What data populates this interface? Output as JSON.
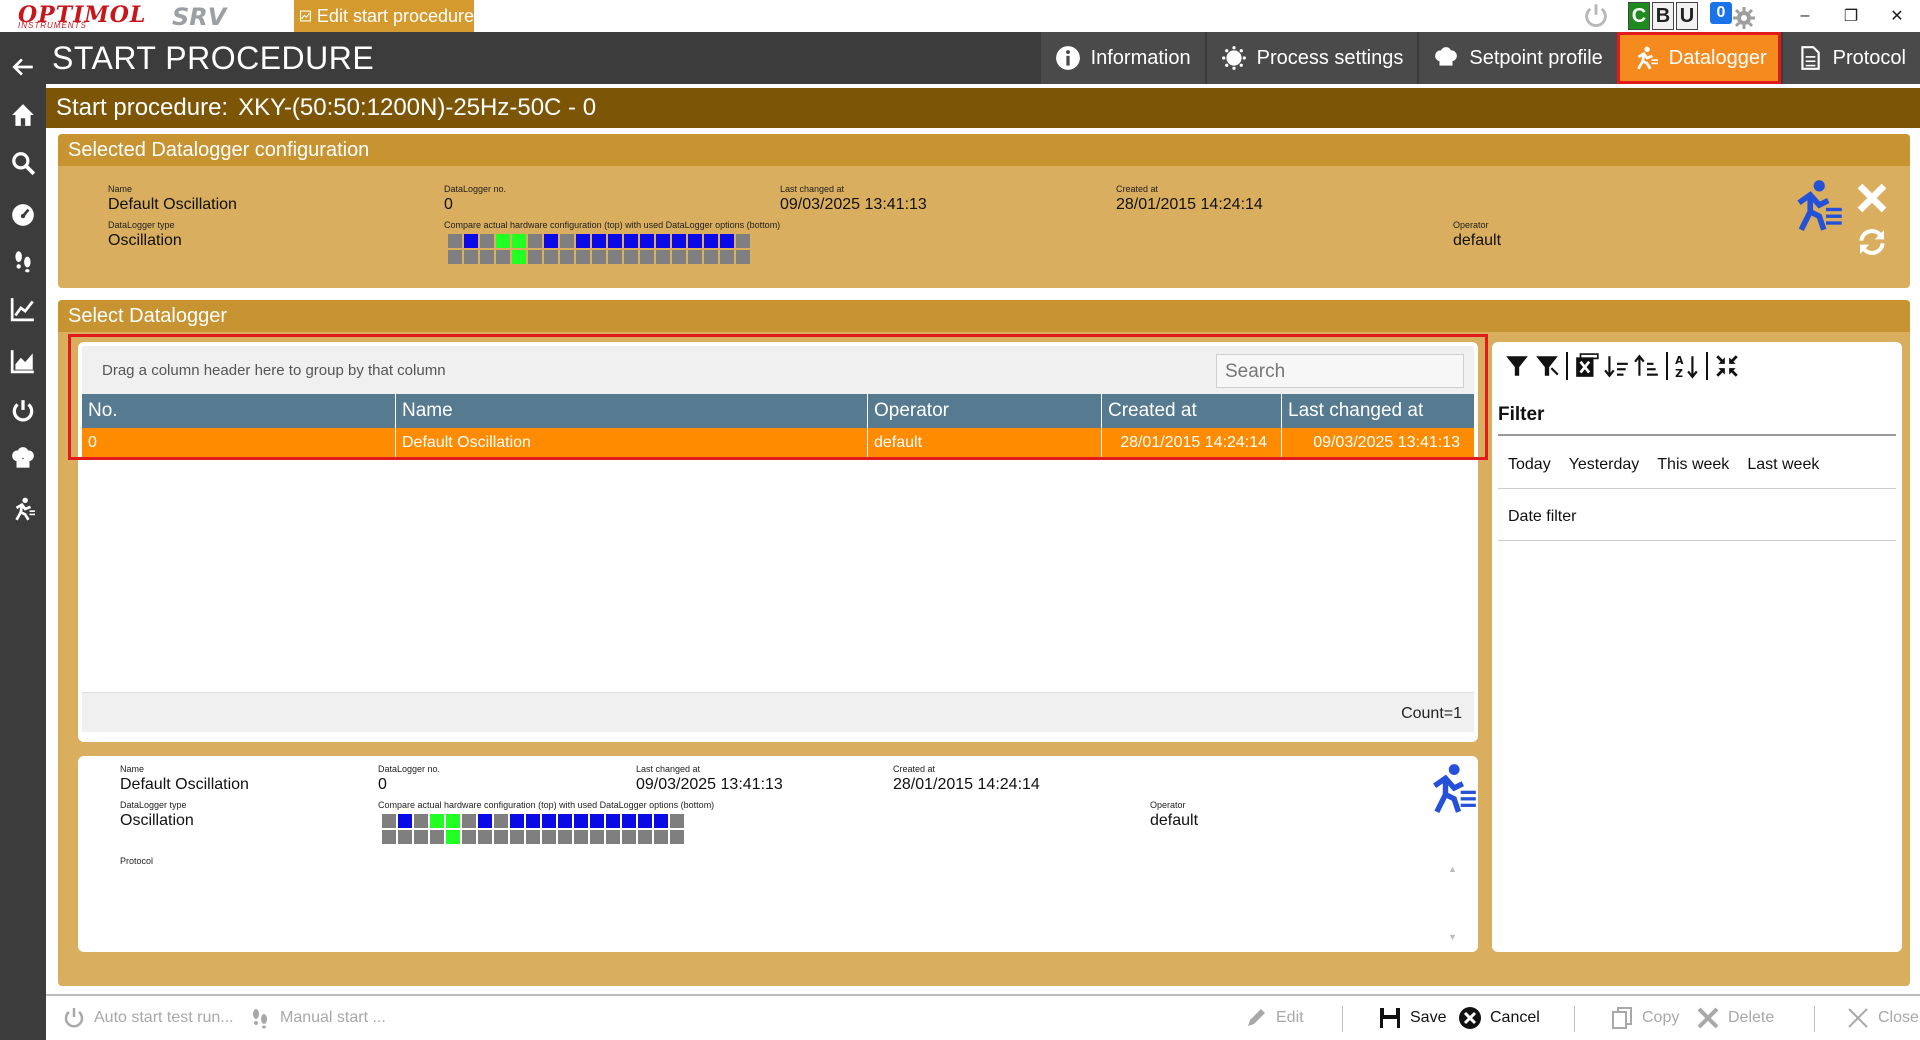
{
  "app": {
    "logo_text": "OPTIMOL",
    "logo_subtext": "INSTRUMENTS",
    "product": "SRV",
    "edit_tab_label": "Edit start procedure",
    "cbu": [
      "C",
      "B",
      "U"
    ],
    "notification_count": "0"
  },
  "header": {
    "title": "START PROCEDURE",
    "tabs": [
      {
        "label": "Information",
        "icon": "info-icon",
        "active": false
      },
      {
        "label": "Process settings",
        "icon": "process-settings-icon",
        "active": false
      },
      {
        "label": "Setpoint profile",
        "icon": "setpoint-profile-icon",
        "active": false
      },
      {
        "label": "Datalogger",
        "icon": "datalogger-icon",
        "active": true
      },
      {
        "label": "Protocol",
        "icon": "protocol-icon",
        "active": false
      }
    ]
  },
  "subheader": {
    "label": "Start procedure:",
    "value": "XKY-(50:50:1200N)-25Hz-50C - 0"
  },
  "selected_config": {
    "heading": "Selected Datalogger configuration",
    "name_label": "Name",
    "name_value": "Default Oscillation",
    "type_label": "DataLogger type",
    "type_value": "Oscillation",
    "no_label": "DataLogger no.",
    "no_value": "0",
    "compare_label": "Compare actual hardware configuration (top) with used DataLogger options (bottom)",
    "last_changed_label": "Last changed at",
    "last_changed_value": "09/03/2025 13:41:13",
    "created_label": "Created at",
    "created_value": "28/01/2015 14:24:14",
    "operator_label": "Operator",
    "operator_value": "default",
    "hw_top": [
      "x",
      "b",
      "x",
      "g",
      "g",
      "x",
      "b",
      "x",
      "b",
      "b",
      "b",
      "b",
      "b",
      "b",
      "b",
      "b",
      "b",
      "b",
      "x"
    ],
    "hw_bottom": [
      "x",
      "x",
      "x",
      "x",
      "g",
      "x",
      "x",
      "x",
      "x",
      "x",
      "x",
      "x",
      "x",
      "x",
      "x",
      "x",
      "x",
      "x",
      "x"
    ]
  },
  "select_datalogger": {
    "heading": "Select Datalogger",
    "group_hint": "Drag a column header here to group by that column",
    "search_placeholder": "Search",
    "columns": [
      "No.",
      "Name",
      "Operator",
      "Created at",
      "Last changed at"
    ],
    "rows": [
      {
        "no": "0",
        "name": "Default Oscillation",
        "operator": "default",
        "created": "28/01/2015 14:24:14",
        "changed": "09/03/2025 13:41:13"
      }
    ],
    "count": "Count=1"
  },
  "detail": {
    "name_label": "Name",
    "name_value": "Default Oscillation",
    "type_label": "DataLogger type",
    "type_value": "Oscillation",
    "no_label": "DataLogger no.",
    "no_value": "0",
    "compare_label": "Compare actual hardware configuration (top) with used DataLogger options (bottom)",
    "last_changed_label": "Last changed at",
    "last_changed_value": "09/03/2025 13:41:13",
    "created_label": "Created at",
    "created_value": "28/01/2015 14:24:14",
    "operator_label": "Operator",
    "operator_value": "default",
    "protocol_label": "Protocol"
  },
  "filter": {
    "title": "Filter",
    "options": [
      "Today",
      "Yesterday",
      "This week",
      "Last week"
    ],
    "date_filter": "Date filter"
  },
  "bottom": {
    "auto_start": "Auto start test run...",
    "manual_start": "Manual start ...",
    "edit": "Edit",
    "save": "Save",
    "cancel": "Cancel",
    "copy": "Copy",
    "delete": "Delete",
    "close": "Close"
  },
  "colors": {
    "accent": "#f58a1f",
    "header_bg": "#3c3c3c",
    "subheader_bg": "#7c5507",
    "panel_bg": "#d9ae5f",
    "grid_header": "#567a8f",
    "selection": "#ff8c00",
    "highlight": "#e11b1b"
  }
}
